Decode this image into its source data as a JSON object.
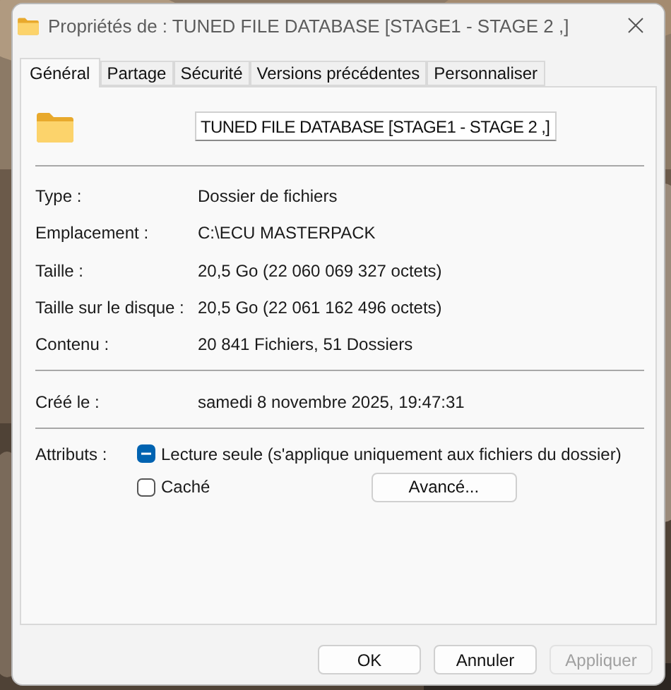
{
  "window": {
    "title": "Propriétés de : TUNED FILE DATABASE [STAGE1 - STAGE 2 ,]"
  },
  "tabs": [
    {
      "label": "Général",
      "selected": true
    },
    {
      "label": "Partage",
      "selected": false
    },
    {
      "label": "Sécurité",
      "selected": false
    },
    {
      "label": "Versions précédentes",
      "selected": false
    },
    {
      "label": "Personnaliser",
      "selected": false
    }
  ],
  "name_field": {
    "value": "TUNED FILE DATABASE [STAGE1 - STAGE 2 ,]"
  },
  "groups": [
    [
      {
        "label": "Type :",
        "value": "Dossier de fichiers"
      },
      {
        "label": "Emplacement :",
        "value": "C:\\ECU MASTERPACK"
      },
      {
        "label": "Taille :",
        "value": "20,5 Go (22 060 069 327 octets)"
      },
      {
        "label": "Taille sur le disque :",
        "value": "20,5 Go (22 061 162 496 octets)"
      },
      {
        "label": "Contenu :",
        "value": "20 841 Fichiers, 51 Dossiers"
      }
    ],
    [
      {
        "label": "Créé le :",
        "value": "samedi 8 novembre 2025, 19:47:31"
      }
    ]
  ],
  "attributes": {
    "label": "Attributs :",
    "options": [
      {
        "label": "Lecture seule (s'applique uniquement aux fichiers du dossier)",
        "checked": false,
        "indeterminate": true
      },
      {
        "label": "Caché",
        "checked": false,
        "indeterminate": false
      }
    ],
    "advanced": "Avancé..."
  },
  "buttons": [
    {
      "label": "OK",
      "disabled": false
    },
    {
      "label": "Annuler",
      "disabled": false
    },
    {
      "label": "Appliquer",
      "disabled": true
    }
  ]
}
